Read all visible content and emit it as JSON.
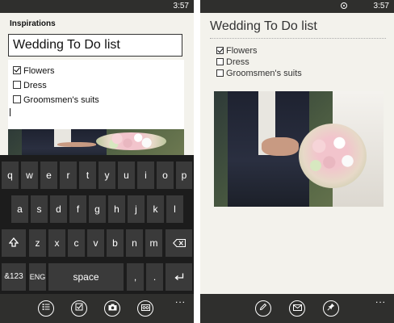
{
  "left_phone": {
    "status": {
      "time": "3:57"
    },
    "notebook_label": "Inspirations",
    "title_value": "Wedding To Do list",
    "checklist": [
      {
        "label": "Flowers",
        "checked": true
      },
      {
        "label": "Dress",
        "checked": false
      },
      {
        "label": "Groomsmen's suits",
        "checked": false
      }
    ],
    "keyboard": {
      "row1": [
        "q",
        "w",
        "e",
        "r",
        "t",
        "y",
        "u",
        "i",
        "o",
        "p"
      ],
      "row2": [
        "a",
        "s",
        "d",
        "f",
        "g",
        "h",
        "j",
        "k",
        "l"
      ],
      "row3": [
        "z",
        "x",
        "c",
        "v",
        "b",
        "n",
        "m"
      ],
      "shift_icon": "shift-arrow-icon",
      "backspace_icon": "backspace-icon",
      "symbols_label": "&123",
      "lang_label": "ENG",
      "space_label": "space",
      "comma": ",",
      "period": ".",
      "enter_icon": "enter-icon"
    },
    "app_bar": {
      "buttons": [
        "bulleted-list-icon",
        "checkbox-list-icon",
        "camera-icon",
        "voice-note-icon"
      ],
      "more": "..."
    }
  },
  "right_phone": {
    "status": {
      "time": "3:57"
    },
    "title": "Wedding To Do list",
    "checklist": [
      {
        "label": "Flowers",
        "checked": true
      },
      {
        "label": "Dress",
        "checked": false
      },
      {
        "label": "Groomsmen's suits",
        "checked": false
      }
    ],
    "app_bar": {
      "buttons": [
        "edit-pencil-icon",
        "email-icon",
        "pin-icon"
      ],
      "more": "..."
    }
  },
  "colors": {
    "bar": "#2f2f2d",
    "page": "#f3f2ec",
    "key": "#3a3a3a",
    "keyboard_bg": "#1c1c1c"
  }
}
